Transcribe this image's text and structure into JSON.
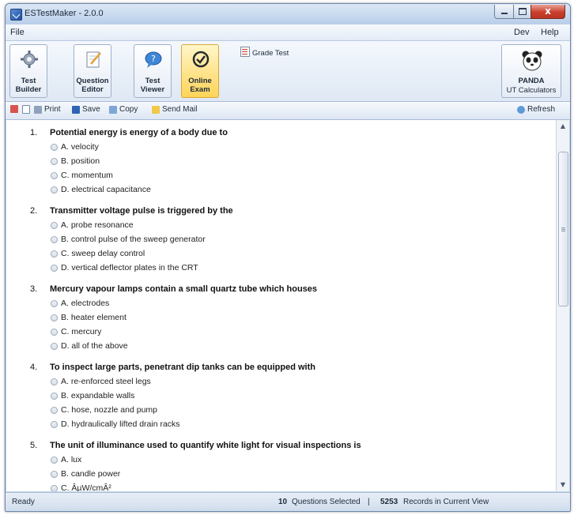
{
  "window": {
    "title": "ESTestMaker - 2.0.0",
    "close_glyph": "x"
  },
  "menu": {
    "file": "File",
    "dev": "Dev",
    "help": "Help"
  },
  "ribbon": {
    "buttons": [
      {
        "label": "Test\nBuilder",
        "icon": "gear-icon"
      },
      {
        "label": "Question\nEditor",
        "icon": "notepad-pencil-icon"
      },
      {
        "label": "Test\nViewer",
        "icon": "chat-bubble-icon"
      },
      {
        "label": "Online\nExam",
        "icon": "check-circle-icon"
      }
    ],
    "grade_test": "Grade Test",
    "panda": {
      "title": "PANDA",
      "subtitle": "UT Calculators",
      "icon": "panda-icon"
    }
  },
  "toolbar": {
    "print": "Print",
    "save": "Save",
    "copy": "Copy",
    "send_mail": "Send Mail",
    "refresh": "Refresh"
  },
  "questions": [
    {
      "num": "1.",
      "text": "Potential energy is energy of a body due to",
      "options": [
        "A. velocity",
        "B. position",
        "C. momentum",
        "D. electrical capacitance"
      ]
    },
    {
      "num": "2.",
      "text": "Transmitter voltage pulse is triggered by the",
      "options": [
        "A. probe resonance",
        "B. control pulse of the sweep generator",
        "C. sweep delay control",
        "D. vertical deflector plates in the CRT"
      ]
    },
    {
      "num": "3.",
      "text": "Mercury vapour lamps contain a small quartz tube which houses",
      "options": [
        "A. electrodes",
        "B. heater element",
        "C. mercury",
        "D. all of the above"
      ]
    },
    {
      "num": "4.",
      "text": "To inspect large parts, penetrant dip tanks can be equipped with",
      "options": [
        "A. re-enforced steel legs",
        "B. expandable walls",
        "C. hose, nozzle and pump",
        "D. hydraulically lifted drain racks"
      ]
    },
    {
      "num": "5.",
      "text": "The unit of illuminance used to quantify white light for visual inspections is",
      "options": [
        "A. lux",
        "B. candle power",
        "C. ÂµW/cmÂ²"
      ]
    }
  ],
  "status": {
    "ready": "Ready",
    "selected_count": "10",
    "selected_label": "Questions Selected",
    "separator": "|",
    "records_count": "5253",
    "records_label": "Records in Current View"
  }
}
